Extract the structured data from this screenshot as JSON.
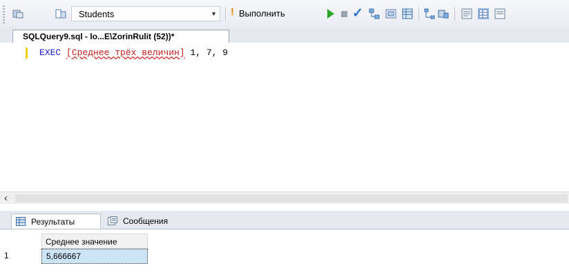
{
  "toolbar": {
    "database_value": "Students",
    "execute_label": "Выполнить"
  },
  "query_tab": {
    "title": "SQLQuery9.sql - lo...E\\ZorinRulit (52))*"
  },
  "editor": {
    "keyword": "EXEC",
    "object_name": "[Среднее трёх величин]",
    "arguments": " 1, 7, 9"
  },
  "results": {
    "tabs": [
      {
        "label": "Результаты"
      },
      {
        "label": "Сообщения"
      }
    ],
    "column_header": "Среднее значение",
    "row_number": "1",
    "cell_value": "5,666667"
  }
}
